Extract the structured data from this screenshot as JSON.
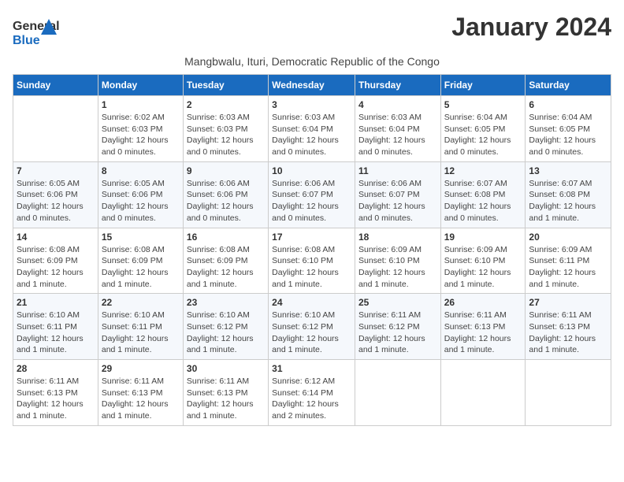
{
  "logo": {
    "part1": "General",
    "part2": "Blue"
  },
  "title": "January 2024",
  "subtitle": "Mangbwalu, Ituri, Democratic Republic of the Congo",
  "days_of_week": [
    "Sunday",
    "Monday",
    "Tuesday",
    "Wednesday",
    "Thursday",
    "Friday",
    "Saturday"
  ],
  "weeks": [
    [
      {
        "num": "",
        "detail": ""
      },
      {
        "num": "1",
        "detail": "Sunrise: 6:02 AM\nSunset: 6:03 PM\nDaylight: 12 hours\nand 0 minutes."
      },
      {
        "num": "2",
        "detail": "Sunrise: 6:03 AM\nSunset: 6:03 PM\nDaylight: 12 hours\nand 0 minutes."
      },
      {
        "num": "3",
        "detail": "Sunrise: 6:03 AM\nSunset: 6:04 PM\nDaylight: 12 hours\nand 0 minutes."
      },
      {
        "num": "4",
        "detail": "Sunrise: 6:03 AM\nSunset: 6:04 PM\nDaylight: 12 hours\nand 0 minutes."
      },
      {
        "num": "5",
        "detail": "Sunrise: 6:04 AM\nSunset: 6:05 PM\nDaylight: 12 hours\nand 0 minutes."
      },
      {
        "num": "6",
        "detail": "Sunrise: 6:04 AM\nSunset: 6:05 PM\nDaylight: 12 hours\nand 0 minutes."
      }
    ],
    [
      {
        "num": "7",
        "detail": "Sunrise: 6:05 AM\nSunset: 6:06 PM\nDaylight: 12 hours\nand 0 minutes."
      },
      {
        "num": "8",
        "detail": "Sunrise: 6:05 AM\nSunset: 6:06 PM\nDaylight: 12 hours\nand 0 minutes."
      },
      {
        "num": "9",
        "detail": "Sunrise: 6:06 AM\nSunset: 6:06 PM\nDaylight: 12 hours\nand 0 minutes."
      },
      {
        "num": "10",
        "detail": "Sunrise: 6:06 AM\nSunset: 6:07 PM\nDaylight: 12 hours\nand 0 minutes."
      },
      {
        "num": "11",
        "detail": "Sunrise: 6:06 AM\nSunset: 6:07 PM\nDaylight: 12 hours\nand 0 minutes."
      },
      {
        "num": "12",
        "detail": "Sunrise: 6:07 AM\nSunset: 6:08 PM\nDaylight: 12 hours\nand 0 minutes."
      },
      {
        "num": "13",
        "detail": "Sunrise: 6:07 AM\nSunset: 6:08 PM\nDaylight: 12 hours\nand 1 minute."
      }
    ],
    [
      {
        "num": "14",
        "detail": "Sunrise: 6:08 AM\nSunset: 6:09 PM\nDaylight: 12 hours\nand 1 minute."
      },
      {
        "num": "15",
        "detail": "Sunrise: 6:08 AM\nSunset: 6:09 PM\nDaylight: 12 hours\nand 1 minute."
      },
      {
        "num": "16",
        "detail": "Sunrise: 6:08 AM\nSunset: 6:09 PM\nDaylight: 12 hours\nand 1 minute."
      },
      {
        "num": "17",
        "detail": "Sunrise: 6:08 AM\nSunset: 6:10 PM\nDaylight: 12 hours\nand 1 minute."
      },
      {
        "num": "18",
        "detail": "Sunrise: 6:09 AM\nSunset: 6:10 PM\nDaylight: 12 hours\nand 1 minute."
      },
      {
        "num": "19",
        "detail": "Sunrise: 6:09 AM\nSunset: 6:10 PM\nDaylight: 12 hours\nand 1 minute."
      },
      {
        "num": "20",
        "detail": "Sunrise: 6:09 AM\nSunset: 6:11 PM\nDaylight: 12 hours\nand 1 minute."
      }
    ],
    [
      {
        "num": "21",
        "detail": "Sunrise: 6:10 AM\nSunset: 6:11 PM\nDaylight: 12 hours\nand 1 minute."
      },
      {
        "num": "22",
        "detail": "Sunrise: 6:10 AM\nSunset: 6:11 PM\nDaylight: 12 hours\nand 1 minute."
      },
      {
        "num": "23",
        "detail": "Sunrise: 6:10 AM\nSunset: 6:12 PM\nDaylight: 12 hours\nand 1 minute."
      },
      {
        "num": "24",
        "detail": "Sunrise: 6:10 AM\nSunset: 6:12 PM\nDaylight: 12 hours\nand 1 minute."
      },
      {
        "num": "25",
        "detail": "Sunrise: 6:11 AM\nSunset: 6:12 PM\nDaylight: 12 hours\nand 1 minute."
      },
      {
        "num": "26",
        "detail": "Sunrise: 6:11 AM\nSunset: 6:13 PM\nDaylight: 12 hours\nand 1 minute."
      },
      {
        "num": "27",
        "detail": "Sunrise: 6:11 AM\nSunset: 6:13 PM\nDaylight: 12 hours\nand 1 minute."
      }
    ],
    [
      {
        "num": "28",
        "detail": "Sunrise: 6:11 AM\nSunset: 6:13 PM\nDaylight: 12 hours\nand 1 minute."
      },
      {
        "num": "29",
        "detail": "Sunrise: 6:11 AM\nSunset: 6:13 PM\nDaylight: 12 hours\nand 1 minute."
      },
      {
        "num": "30",
        "detail": "Sunrise: 6:11 AM\nSunset: 6:13 PM\nDaylight: 12 hours\nand 1 minute."
      },
      {
        "num": "31",
        "detail": "Sunrise: 6:12 AM\nSunset: 6:14 PM\nDaylight: 12 hours\nand 2 minutes."
      },
      {
        "num": "",
        "detail": ""
      },
      {
        "num": "",
        "detail": ""
      },
      {
        "num": "",
        "detail": ""
      }
    ]
  ]
}
